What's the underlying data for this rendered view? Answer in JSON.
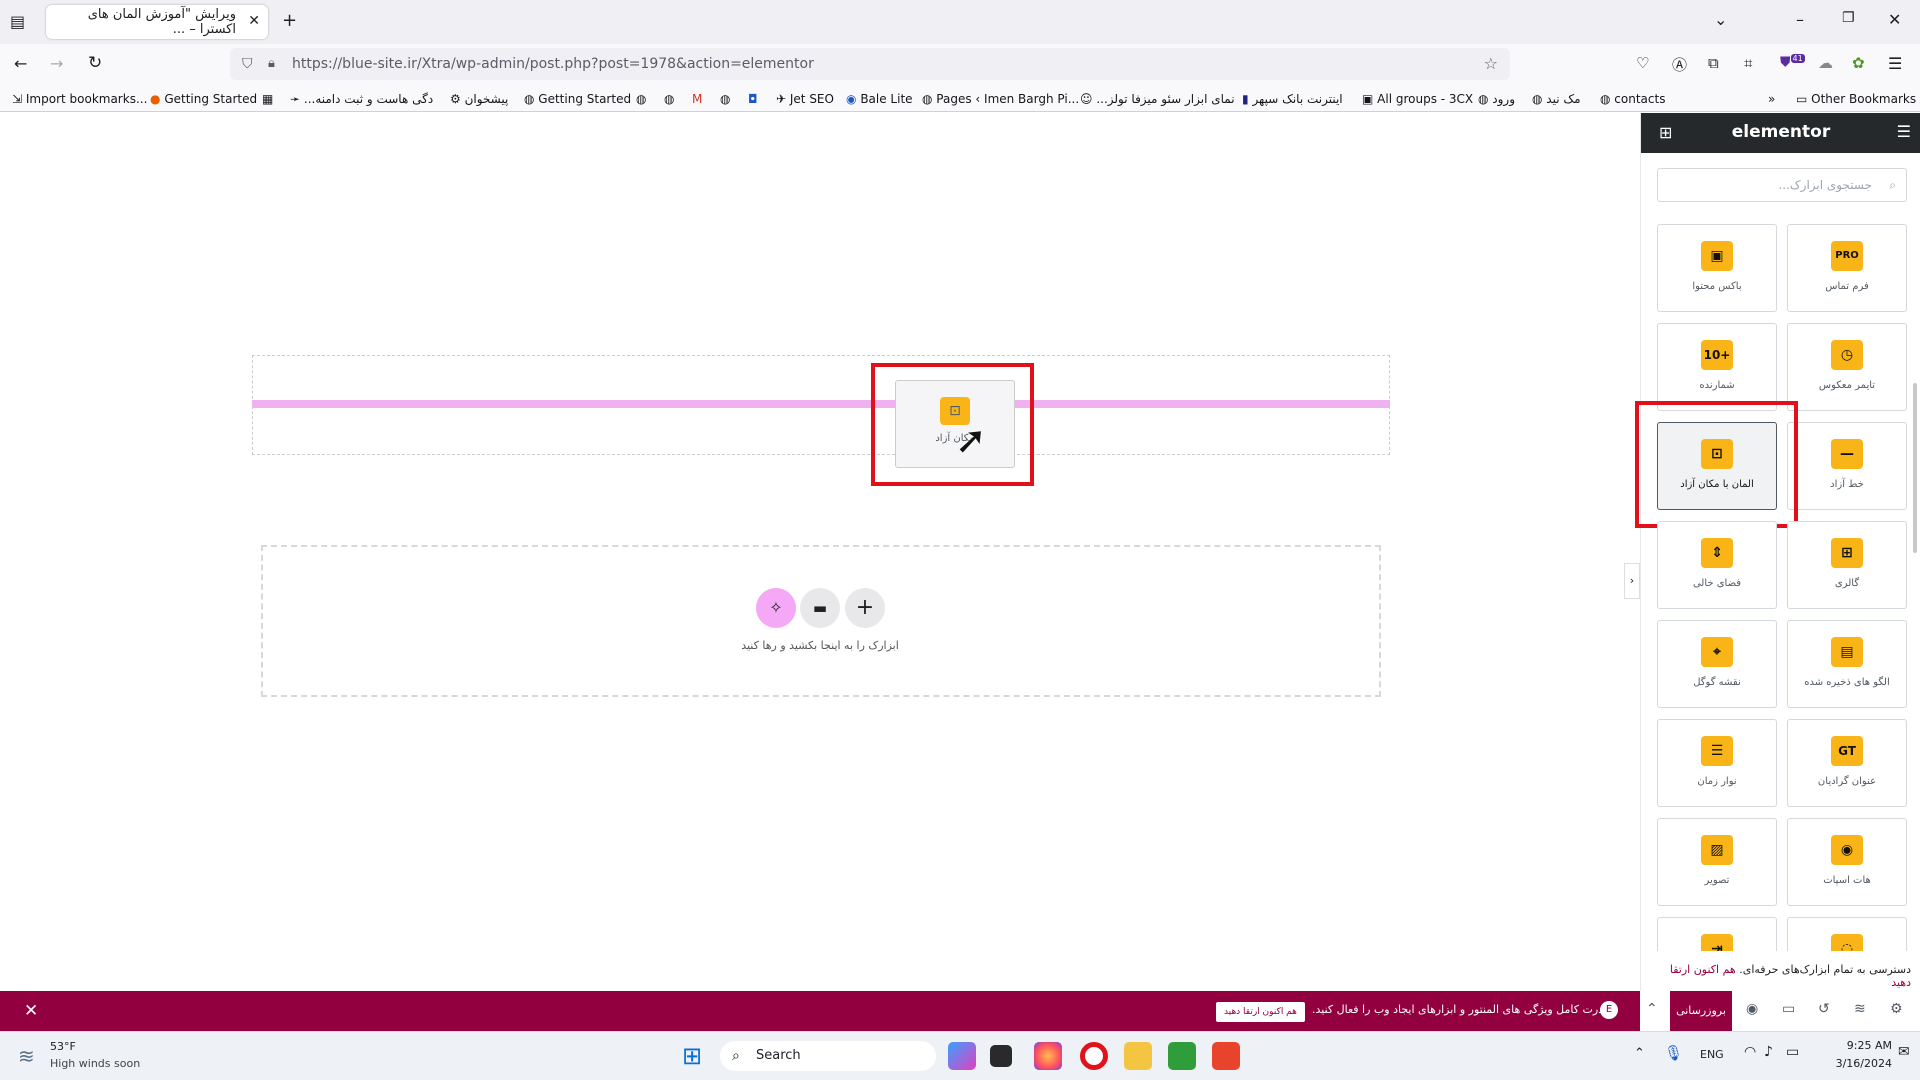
{
  "browser": {
    "tab_title": "ویرایش \"آموزش المان های اکسترا – ...",
    "url": "https://blue-site.ir/Xtra/wp-admin/post.php?post=1978&action=elementor",
    "extension_badge": "41",
    "bookmarks": [
      "Import bookmarks...",
      "Getting Started",
      "...دگی هاست و ثبت دامنه",
      "پیشخوان",
      "Getting Started",
      "Jet SEO",
      "Bale Lite",
      "Pages ‹ Imen Bargh Pi...",
      "...نمای ابزار سئو میزفا تولز",
      "اینترنت بانک سپهر",
      "All groups - 3CX",
      "ورود",
      "مک نید",
      "contacts",
      "Other Bookmarks"
    ]
  },
  "panel": {
    "brand": "elementor",
    "search_placeholder": "جستجوی ابزارک...",
    "widgets": [
      {
        "label": "فرم تماس",
        "icon": "PRO"
      },
      {
        "label": "باکس محتوا",
        "icon": "▣"
      },
      {
        "label": "تایمر معکوس",
        "icon": "◷"
      },
      {
        "label": "شمارنده",
        "icon": "10+"
      },
      {
        "label": "خط آزاد",
        "icon": "—"
      },
      {
        "label": "المان با مکان آزاد",
        "icon": "⊡"
      },
      {
        "label": "گالری",
        "icon": "⊞"
      },
      {
        "label": "فضای خالی",
        "icon": "⇕"
      },
      {
        "label": "الگو های ذخیره شده",
        "icon": "▤"
      },
      {
        "label": "نقشه گوگل",
        "icon": "⌖"
      },
      {
        "label": "عنوان گرادیان",
        "icon": "GT"
      },
      {
        "label": "نوار زمان",
        "icon": "☰"
      },
      {
        "label": "هات اسپات",
        "icon": "◉"
      },
      {
        "label": "تصویر",
        "icon": "▨"
      }
    ],
    "promo_text": "دسترسی به تمام ابزارک‌های حرفه‌ای.",
    "promo_link": "هم اکنون ارتقا دهید",
    "update_label": "بروزرسانی"
  },
  "canvas": {
    "drag_label": "مکان آزاد",
    "drop_hint": "ابزارک را به اینجا بکشید و رها کنید"
  },
  "notice": {
    "text": "قدرت کامل ویژگی های المنتور و ابزارهای ایجاد وب را فعال کنید.",
    "button": "هم اکنون ارتقا دهید"
  },
  "taskbar": {
    "weather_temp": "53°F",
    "weather_desc": "High winds soon",
    "search_label": "Search",
    "lang": "ENG",
    "time": "9:25 AM",
    "date": "3/16/2024"
  }
}
